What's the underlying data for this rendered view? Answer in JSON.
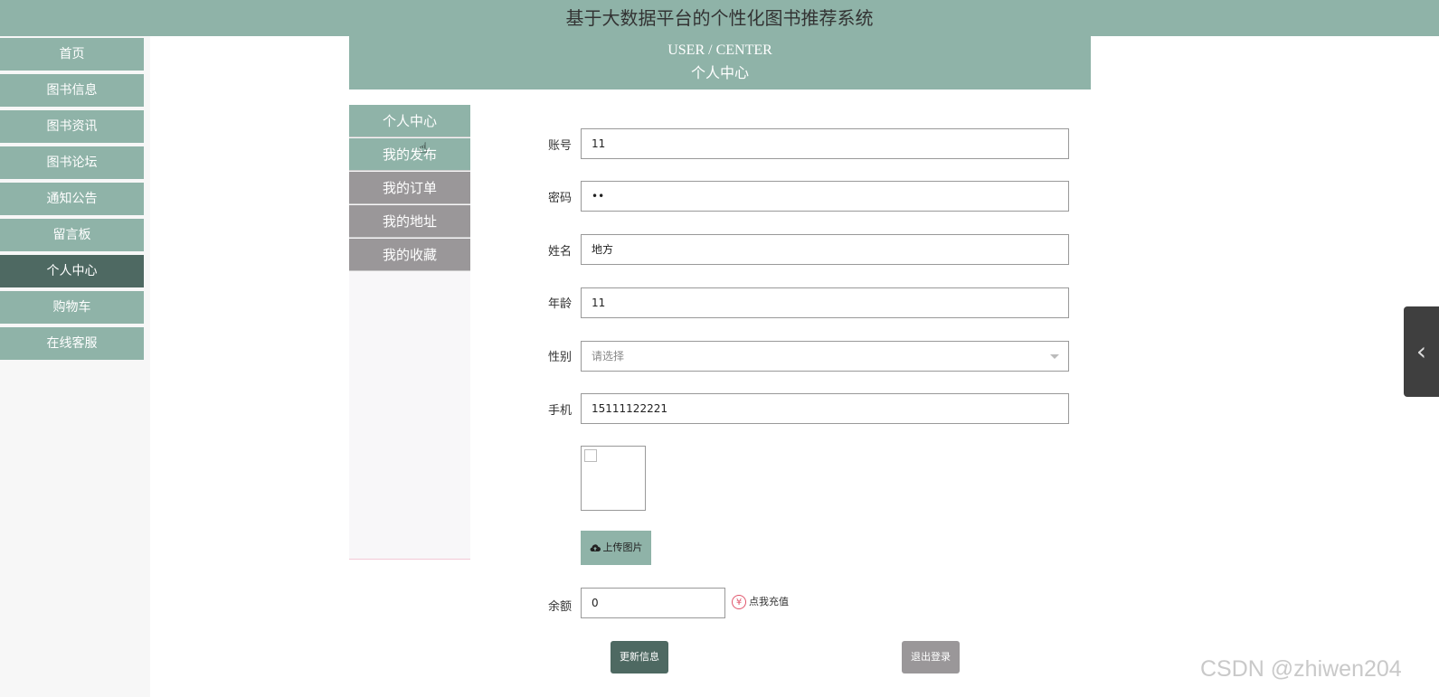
{
  "app": {
    "title": "基于大数据平台的个性化图书推荐系统"
  },
  "sidebar": {
    "items": [
      {
        "label": "首页"
      },
      {
        "label": "图书信息"
      },
      {
        "label": "图书资讯"
      },
      {
        "label": "图书论坛"
      },
      {
        "label": "通知公告"
      },
      {
        "label": "留言板"
      },
      {
        "label": "个人中心",
        "active": true
      },
      {
        "label": "购物车"
      },
      {
        "label": "在线客服"
      }
    ]
  },
  "banner": {
    "title_en": "USER / CENTER",
    "title_cn": "个人中心"
  },
  "subnav": {
    "items": [
      {
        "label": "个人中心",
        "active": true
      },
      {
        "label": "我的发布"
      },
      {
        "label": "我的订单"
      },
      {
        "label": "我的地址"
      },
      {
        "label": "我的收藏"
      }
    ]
  },
  "form": {
    "account": {
      "label": "账号",
      "value": "11"
    },
    "password": {
      "label": "密码",
      "value": "••"
    },
    "name": {
      "label": "姓名",
      "value": "地方"
    },
    "age": {
      "label": "年龄",
      "value": "11"
    },
    "gender": {
      "label": "性别",
      "placeholder": "请选择"
    },
    "phone": {
      "label": "手机",
      "value": "15111122221"
    },
    "upload_label": "上传图片",
    "balance": {
      "label": "余额",
      "value": "0"
    },
    "recharge_label": "点我充值",
    "update_label": "更新信息",
    "logout_label": "退出登录"
  },
  "icons": {
    "upload": "cloud-upload-icon",
    "yen": "yen-icon",
    "collapse": "chevron-left-icon"
  },
  "colors": {
    "primary": "#8fb3a8",
    "active": "#4e6962",
    "secondary": "#9a9799"
  },
  "watermark": "CSDN @zhiwen204"
}
